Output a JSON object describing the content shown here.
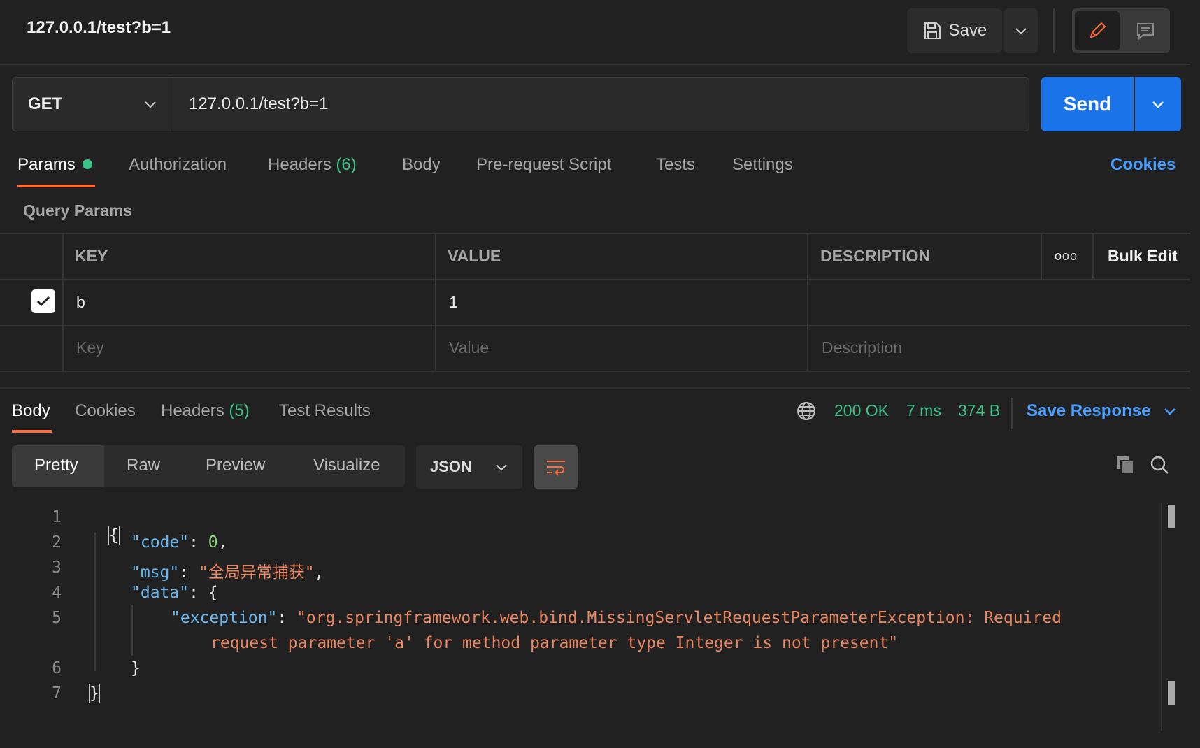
{
  "top": {
    "title": "127.0.0.1/test?b=1",
    "save_label": "Save"
  },
  "request": {
    "method": "GET",
    "url": "127.0.0.1/test?b=1",
    "send_label": "Send"
  },
  "request_tabs": {
    "params": "Params",
    "authorization": "Authorization",
    "headers": "Headers",
    "headers_count": "(6)",
    "body": "Body",
    "pre_request": "Pre-request Script",
    "tests": "Tests",
    "settings": "Settings",
    "cookies": "Cookies"
  },
  "params": {
    "section_title": "Query Params",
    "columns": {
      "key": "KEY",
      "value": "VALUE",
      "description": "DESCRIPTION"
    },
    "more_label": "ooo",
    "bulk_edit": "Bulk Edit",
    "rows": [
      {
        "key": "b",
        "value": "1",
        "description": "",
        "checked": true
      }
    ],
    "placeholders": {
      "key": "Key",
      "value": "Value",
      "description": "Description"
    }
  },
  "response": {
    "tabs": {
      "body": "Body",
      "cookies": "Cookies",
      "headers": "Headers",
      "headers_count": "(5)",
      "test_results": "Test Results"
    },
    "status": "200 OK",
    "time": "7 ms",
    "size": "374 B",
    "save_response": "Save Response",
    "formats": {
      "pretty": "Pretty",
      "raw": "Raw",
      "preview": "Preview",
      "visualize": "Visualize"
    },
    "language": "JSON",
    "lines": {
      "l1_open": "{",
      "l2_key": "\"code\"",
      "l2_val": "0",
      "l3_key": "\"msg\"",
      "l3_val": "\"全局异常捕获\"",
      "l4_key": "\"data\"",
      "l4_open": "{",
      "l5_key": "\"exception\"",
      "l5_val_a": "\"org.springframework.web.bind.MissingServletRequestParameterException: Required",
      "l5_val_b": "request parameter 'a' for method parameter type Integer is not present\"",
      "l6_close": "}",
      "l7_close": "}"
    },
    "line_numbers": [
      "1",
      "2",
      "3",
      "4",
      "5",
      "6",
      "7"
    ]
  },
  "colors": {
    "accent_orange": "#ff6c37",
    "send_blue": "#1a73e8",
    "success_green": "#3dc28a",
    "link_blue": "#4a9eff"
  }
}
